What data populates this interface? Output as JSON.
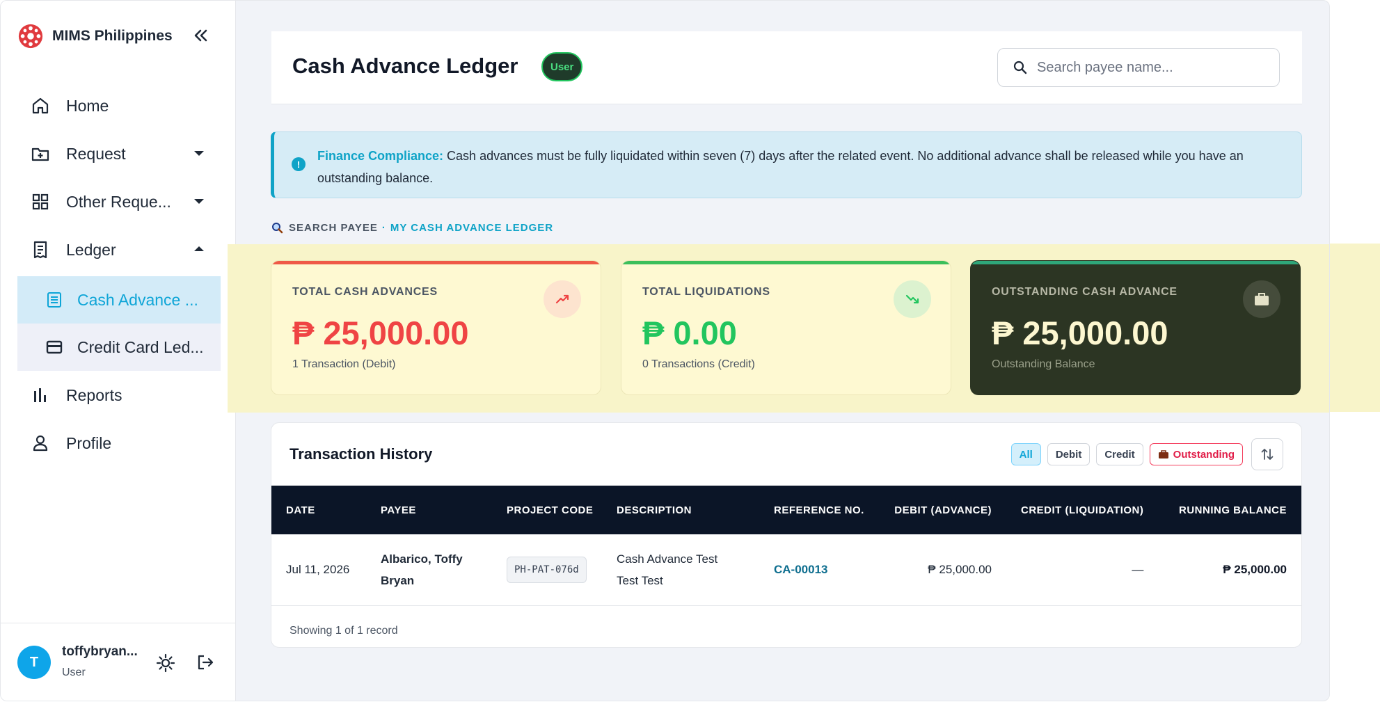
{
  "sidebar": {
    "brand": "MIMS Philippines",
    "items": [
      {
        "label": "Home",
        "icon": "home-icon"
      },
      {
        "label": "Request",
        "icon": "folder-plus-icon"
      },
      {
        "label": "Other Reque...",
        "icon": "grid-icon"
      },
      {
        "label": "Ledger",
        "icon": "ledger-icon"
      },
      {
        "label": "Reports",
        "icon": "bar-chart-icon"
      },
      {
        "label": "Profile",
        "icon": "user-icon"
      }
    ],
    "ledger_sub": [
      {
        "label": "Cash Advance ...",
        "icon": "document-list-icon",
        "active": true
      },
      {
        "label": "Credit Card Led...",
        "icon": "credit-card-icon",
        "active": false
      }
    ],
    "user": {
      "initial": "T",
      "name": "toffybryan...",
      "role": "User"
    }
  },
  "header": {
    "title": "Cash Advance Ledger",
    "badge": "User",
    "search_placeholder": "Search payee name..."
  },
  "notice": {
    "title": "Finance Compliance:",
    "text": " Cash advances must be fully liquidated within seven (7) days after the related event. No additional advance shall be released while you have an outstanding balance."
  },
  "breadcrumb": {
    "part1": "SEARCH PAYEE",
    "separator": "·",
    "part2": "MY CASH ADVANCE LEDGER"
  },
  "cards": [
    {
      "label": "TOTAL CASH ADVANCES",
      "value": "₱ 25,000.00",
      "sub": "1 Transaction (Debit)",
      "color": "#ef4444"
    },
    {
      "label": "TOTAL LIQUIDATIONS",
      "value": "₱ 0.00",
      "sub": "0 Transactions (Credit)",
      "color": "#22c55e"
    },
    {
      "label": "OUTSTANDING CASH ADVANCE",
      "value": "₱ 25,000.00",
      "sub": "Outstanding Balance",
      "color": "#fdf7d0"
    }
  ],
  "transactions": {
    "title": "Transaction History",
    "filters": [
      "All",
      "Debit",
      "Credit",
      "Outstanding"
    ],
    "active_filter": "All",
    "columns": [
      "DATE",
      "PAYEE",
      "PROJECT CODE",
      "DESCRIPTION",
      "REFERENCE NO.",
      "DEBIT (ADVANCE)",
      "CREDIT (LIQUIDATION)",
      "RUNNING BALANCE"
    ],
    "rows": [
      {
        "date": "Jul 11, 2026",
        "payee": "Albarico, Toffy Bryan",
        "project_code": "PH-PAT-076d",
        "description": "Cash Advance Test Test Test",
        "reference": "CA-00013",
        "debit": "₱ 25,000.00",
        "credit": "—",
        "balance": "₱ 25,000.00"
      }
    ],
    "footer": "Showing 1 of 1 record"
  }
}
